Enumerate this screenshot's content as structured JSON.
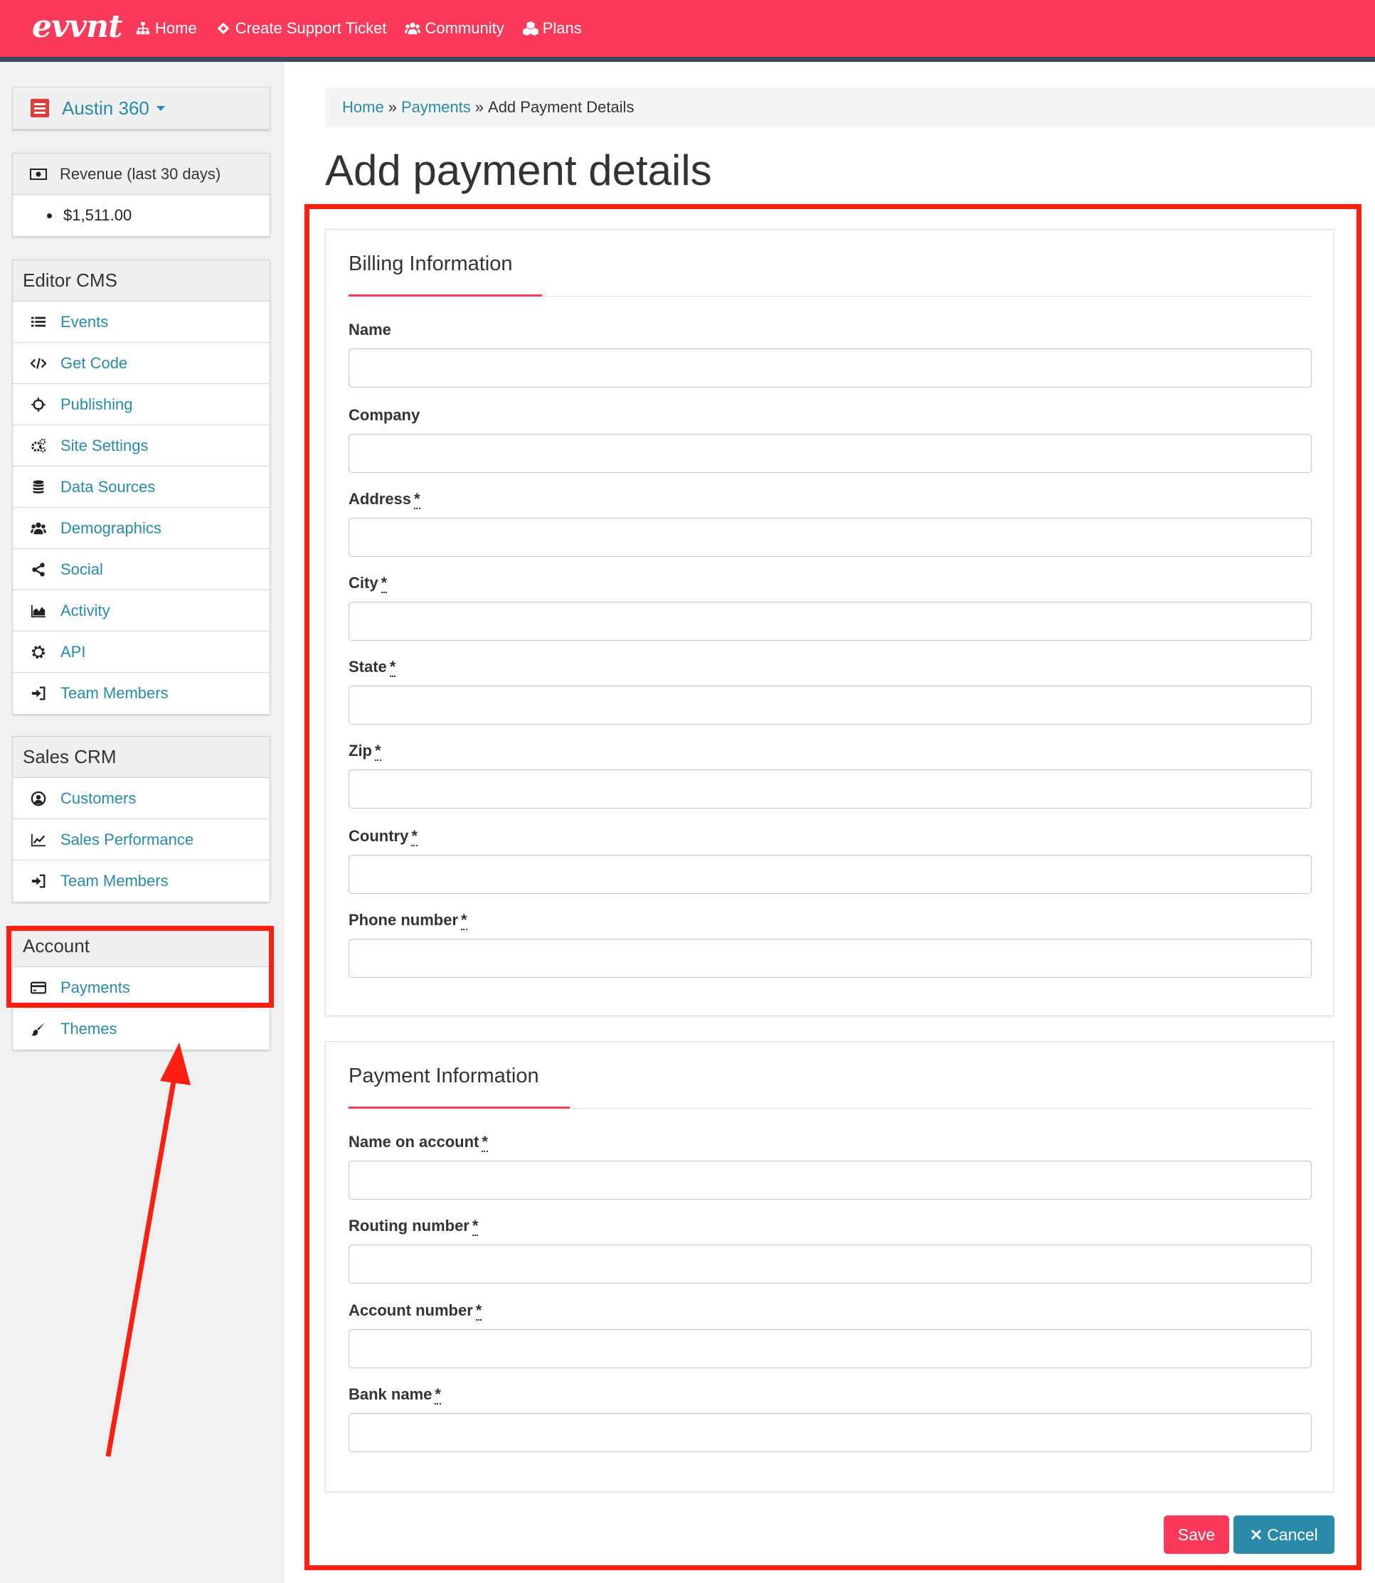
{
  "navbar": {
    "brand": "evvnt",
    "links": [
      {
        "label": "Home",
        "icon": "sitemap-icon"
      },
      {
        "label": "Create Support Ticket",
        "icon": "ticket-icon"
      },
      {
        "label": "Community",
        "icon": "users-icon"
      },
      {
        "label": "Plans",
        "icon": "cubes-icon"
      }
    ],
    "accent_color": "#f93a5a"
  },
  "sidebar": {
    "site_name": "Austin 360",
    "revenue": {
      "heading": "Revenue (last 30 days)",
      "value": "$1,511.00"
    },
    "editor_cms": {
      "heading": "Editor CMS",
      "items": [
        {
          "label": "Events",
          "icon": "list-icon"
        },
        {
          "label": "Get Code",
          "icon": "code-icon"
        },
        {
          "label": "Publishing",
          "icon": "crosshairs-icon"
        },
        {
          "label": "Site Settings",
          "icon": "cogs-icon"
        },
        {
          "label": "Data Sources",
          "icon": "database-icon"
        },
        {
          "label": "Demographics",
          "icon": "users-icon"
        },
        {
          "label": "Social",
          "icon": "share-icon"
        },
        {
          "label": "Activity",
          "icon": "area-chart-icon"
        },
        {
          "label": "API",
          "icon": "gear-icon"
        },
        {
          "label": "Team Members",
          "icon": "sign-in-icon"
        }
      ]
    },
    "sales_crm": {
      "heading": "Sales CRM",
      "items": [
        {
          "label": "Customers",
          "icon": "user-circle-icon"
        },
        {
          "label": "Sales Performance",
          "icon": "line-chart-icon"
        },
        {
          "label": "Team Members",
          "icon": "sign-in-icon"
        }
      ]
    },
    "account": {
      "heading": "Account",
      "items": [
        {
          "label": "Payments",
          "icon": "credit-card-icon"
        },
        {
          "label": "Themes",
          "icon": "paint-brush-icon"
        }
      ]
    }
  },
  "breadcrumb": {
    "home": "Home",
    "sep1": "»",
    "payments": "Payments",
    "sep2": "»",
    "current": "Add Payment Details"
  },
  "page_title": "Add payment details",
  "billing": {
    "title": "Billing Information",
    "fields": [
      {
        "label": "Name",
        "required": false,
        "value": ""
      },
      {
        "label": "Company",
        "required": false,
        "value": ""
      },
      {
        "label": "Address",
        "required": true,
        "value": ""
      },
      {
        "label": "City",
        "required": true,
        "value": ""
      },
      {
        "label": "State",
        "required": true,
        "value": ""
      },
      {
        "label": "Zip",
        "required": true,
        "value": ""
      },
      {
        "label": "Country",
        "required": true,
        "value": ""
      },
      {
        "label": "Phone number",
        "required": true,
        "value": ""
      }
    ]
  },
  "payment": {
    "title": "Payment Information",
    "fields": [
      {
        "label": "Name on account",
        "required": true,
        "value": ""
      },
      {
        "label": "Routing number",
        "required": true,
        "value": ""
      },
      {
        "label": "Account number",
        "required": true,
        "value": ""
      },
      {
        "label": "Bank name",
        "required": true,
        "value": ""
      }
    ]
  },
  "required_marker": "*",
  "buttons": {
    "save": "Save",
    "cancel": "Cancel",
    "cancel_icon": "times-icon"
  },
  "annotation_color": "#ff1e12"
}
